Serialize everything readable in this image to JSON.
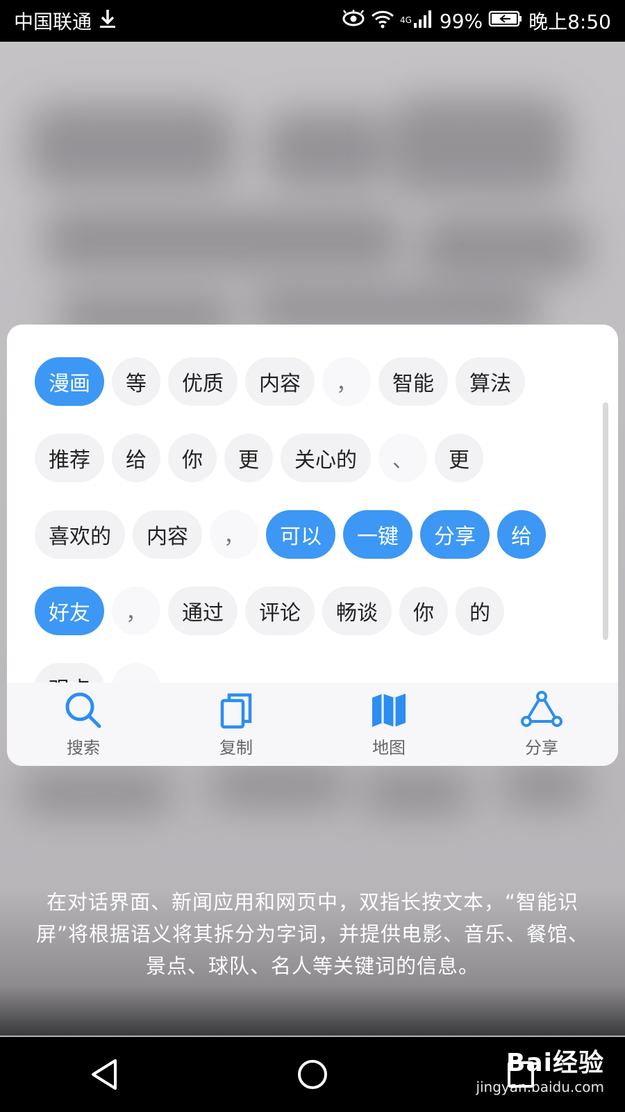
{
  "status_bar": {
    "carrier": "中国联通",
    "network": "4G",
    "battery": "99%",
    "time": "晚上8:50"
  },
  "chip_rows": [
    [
      {
        "text": "漫画",
        "selected": true
      },
      {
        "text": "等",
        "selected": false
      },
      {
        "text": "优质",
        "selected": false
      },
      {
        "text": "内容",
        "selected": false
      },
      {
        "text": "，",
        "selected": false,
        "punct": true
      },
      {
        "text": "智能",
        "selected": false
      },
      {
        "text": "算法",
        "selected": false
      }
    ],
    [
      {
        "text": "推荐",
        "selected": false
      },
      {
        "text": "给",
        "selected": false
      },
      {
        "text": "你",
        "selected": false
      },
      {
        "text": "更",
        "selected": false
      },
      {
        "text": "关心的",
        "selected": false
      },
      {
        "text": "、",
        "selected": false,
        "punct": true
      },
      {
        "text": "更",
        "selected": false
      }
    ],
    [
      {
        "text": "喜欢的",
        "selected": false
      },
      {
        "text": "内容",
        "selected": false
      },
      {
        "text": "，",
        "selected": false,
        "punct": true
      },
      {
        "text": "可以",
        "selected": true
      },
      {
        "text": "一键",
        "selected": true
      },
      {
        "text": "分享",
        "selected": true
      },
      {
        "text": "给",
        "selected": true
      }
    ],
    [
      {
        "text": "好友",
        "selected": true
      },
      {
        "text": "，",
        "selected": false,
        "punct": true
      },
      {
        "text": "通过",
        "selected": false
      },
      {
        "text": "评论",
        "selected": false
      },
      {
        "text": "畅谈",
        "selected": false
      },
      {
        "text": "你",
        "selected": false
      },
      {
        "text": "的",
        "selected": false
      }
    ],
    [
      {
        "text": "观点",
        "selected": false
      },
      {
        "text": "",
        "selected": false,
        "punct": true
      }
    ]
  ],
  "actions": {
    "search": "搜索",
    "copy": "复制",
    "map": "地图",
    "share": "分享"
  },
  "caption": "在对话界面、新闻应用和网页中，双指长按文本，“智能识屏”将根据语义将其拆分为字词，并提供电影、音乐、餐馆、景点、球队、名人等关键词的信息。",
  "watermark": {
    "brand": "Bai经验",
    "url": "jingyan.baidu.com"
  },
  "colors": {
    "accent": "#3d97f4",
    "chip_bg": "#f2f1f4"
  }
}
